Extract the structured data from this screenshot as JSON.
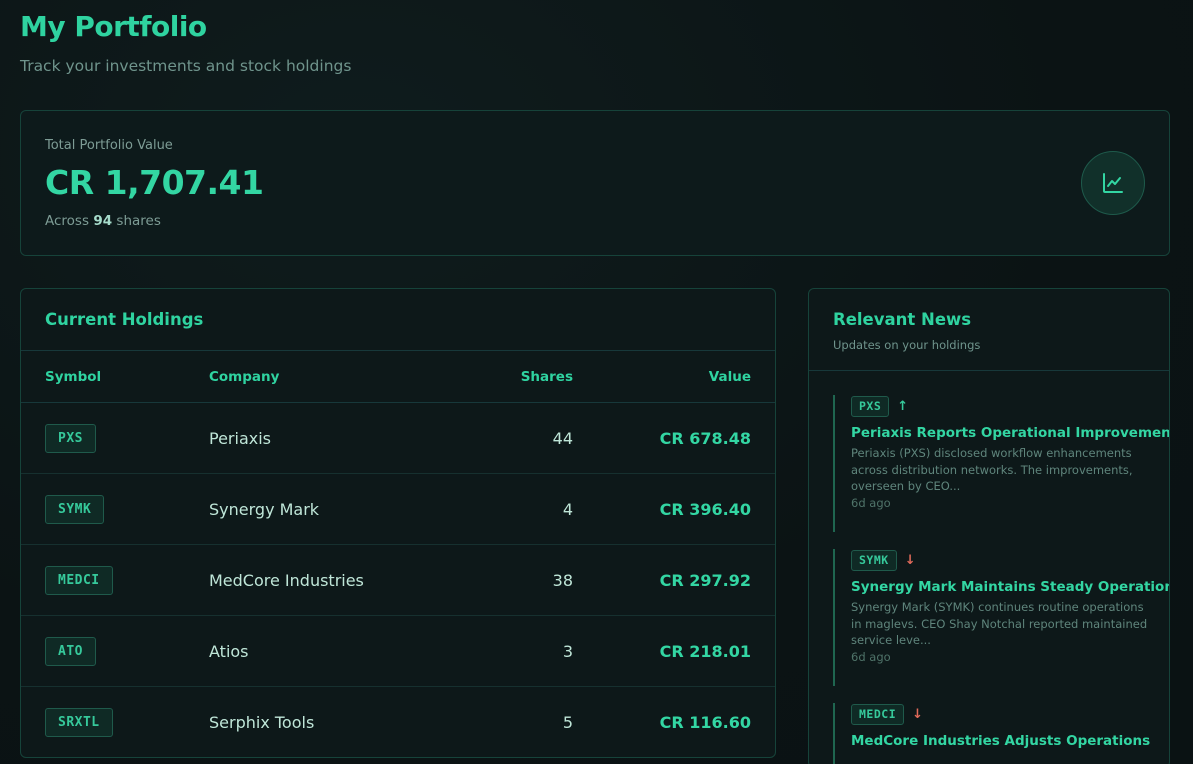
{
  "header": {
    "title": "My Portfolio",
    "subtitle": "Track your investments and stock holdings"
  },
  "summary": {
    "label": "Total Portfolio Value",
    "value": "CR 1,707.41",
    "shares_prefix": "Across",
    "shares_count": "94",
    "shares_suffix": "shares",
    "icon": "trending-chart-icon"
  },
  "holdings": {
    "title": "Current Holdings",
    "columns": [
      "Symbol",
      "Company",
      "Shares",
      "Value"
    ],
    "rows": [
      {
        "symbol": "PXS",
        "company": "Periaxis",
        "shares": "44",
        "value": "CR 678.48"
      },
      {
        "symbol": "SYMK",
        "company": "Synergy Mark",
        "shares": "4",
        "value": "CR 396.40"
      },
      {
        "symbol": "MEDCI",
        "company": "MedCore Industries",
        "shares": "38",
        "value": "CR 297.92"
      },
      {
        "symbol": "ATO",
        "company": "Atios",
        "shares": "3",
        "value": "CR 218.01"
      },
      {
        "symbol": "SRXTL",
        "company": "Serphix Tools",
        "shares": "5",
        "value": "CR 116.60"
      }
    ]
  },
  "news": {
    "title": "Relevant News",
    "subtitle": "Updates on your holdings",
    "items": [
      {
        "symbol": "PXS",
        "direction": "up",
        "arrow": "↑",
        "headline": "Periaxis Reports Operational Improvements",
        "body": "Periaxis (PXS) disclosed workflow enhancements across distribution networks. The improvements, overseen by CEO...",
        "time": "6d ago"
      },
      {
        "symbol": "SYMK",
        "direction": "down",
        "arrow": "↓",
        "headline": "Synergy Mark Maintains Steady Operations",
        "body": "Synergy Mark (SYMK) continues routine operations in maglevs. CEO Shay Notchal reported maintained service leve...",
        "time": "6d ago"
      },
      {
        "symbol": "MEDCI",
        "direction": "down",
        "arrow": "↓",
        "headline": "MedCore Industries Adjusts Operations",
        "body": "",
        "time": ""
      }
    ]
  },
  "colors": {
    "accent": "#2fd3a0",
    "up": "#36c99b",
    "down": "#e06a5a",
    "background": "#0c1516"
  }
}
